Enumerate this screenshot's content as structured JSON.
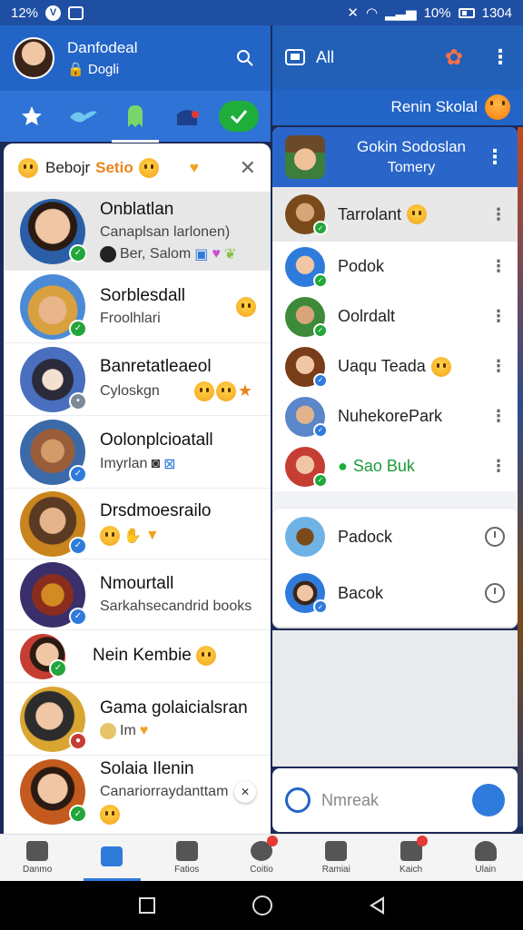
{
  "status_bar": {
    "time": "12%",
    "battery": "10%",
    "clock": "1304"
  },
  "left_header": {
    "name": "Danfodeal",
    "subtitle": "Dogli"
  },
  "left_card": {
    "title": "Bebojr",
    "title_accent": "Setio"
  },
  "chats": [
    {
      "name": "Onblatlan",
      "line1": "Canaplsan larlonen)",
      "line2": "Ber, Salom",
      "avatar_colors": [
        "#2a5fa8",
        "#f1c6a4"
      ],
      "badge": "g",
      "selected": true
    },
    {
      "name": "Sorblesdall",
      "line1": "Froolhlari",
      "avatar_colors": [
        "#4b8bd6",
        "#d9a040"
      ],
      "badge": "g"
    },
    {
      "name": "Banretatleaeol",
      "line1": "Cyloskgn",
      "avatar_colors": [
        "#4a6fbf",
        "#2a2a3a"
      ],
      "badge": "gr"
    },
    {
      "name": "Oolonplcioatall",
      "line1": "Imyrlan",
      "avatar_colors": [
        "#3c6aa8",
        "#9a5d3a"
      ],
      "badge": "b"
    },
    {
      "name": "Drsdmoesrailo",
      "line1": "",
      "avatar_colors": [
        "#c9841d",
        "#5a3a22"
      ],
      "badge": "b"
    },
    {
      "name": "Nmourtall",
      "line1": "Sarkahsecandrid books",
      "avatar_colors": [
        "#3a2f6a",
        "#d28a22"
      ],
      "badge": "b"
    },
    {
      "name": "Nein Kembie",
      "line1": "",
      "avatar_colors": [
        "#c63d33",
        "#f1c6a4"
      ],
      "badge": "g"
    },
    {
      "name": "Gama golaicialsran",
      "line1": "Im",
      "avatar_colors": [
        "#d9a633",
        "#2c2c2c"
      ],
      "badge": "r"
    },
    {
      "name": "Solaia Ilenin",
      "line1": "Canariorraydanttam",
      "avatar_colors": [
        "#c45a1d",
        "#f1c6a4"
      ],
      "badge": "g"
    }
  ],
  "right_header": {
    "title": "All"
  },
  "right_sub": {
    "label": "Renin Skolal"
  },
  "group": {
    "title": "Gokin Sodoslan",
    "subtitle": "Tomery"
  },
  "members": [
    {
      "name": "Tarrolant",
      "avatar_colors": [
        "#7a4a1a",
        "#d8a47a"
      ],
      "selected": true
    },
    {
      "name": "Podok",
      "avatar_colors": [
        "#2f7bdc",
        "#f1c6a4"
      ]
    },
    {
      "name": "Oolrdalt",
      "avatar_colors": [
        "#3d8b3a",
        "#d8a47a"
      ]
    },
    {
      "name": "Uaqu Teada",
      "avatar_colors": [
        "#7a3d1a",
        "#f1c6a4"
      ]
    },
    {
      "name": "NuhekorePark",
      "avatar_colors": [
        "#5b86c9",
        "#e2b38a"
      ]
    },
    {
      "name": "Sao Buk",
      "avatar_colors": [
        "#c63d33",
        "#f1c6a4"
      ],
      "green": true
    }
  ],
  "sub_members": [
    {
      "name": "Padock",
      "avatar_colors": [
        "#6fb3e6",
        "#7a4a1a"
      ]
    },
    {
      "name": "Bacok",
      "avatar_colors": [
        "#2f7bdc",
        "#3a241a"
      ]
    }
  ],
  "composer": {
    "placeholder": "Nmreak"
  },
  "bottom_nav": [
    {
      "label": "Danmo",
      "icon": "home-icon"
    },
    {
      "label": "",
      "icon": "chat-icon",
      "active": true
    },
    {
      "label": "Fatios",
      "icon": "camera-icon"
    },
    {
      "label": "Coitio",
      "icon": "status-icon",
      "dot": true
    },
    {
      "label": "Ramiai",
      "icon": "hat-icon"
    },
    {
      "label": "Kaich",
      "icon": "tv-icon",
      "dot": true
    },
    {
      "label": "Ulain",
      "icon": "profile-icon"
    }
  ],
  "colors": {
    "primary": "#2364c7",
    "accent_green": "#1fae3a",
    "badge_blue": "#2f7bdc"
  }
}
